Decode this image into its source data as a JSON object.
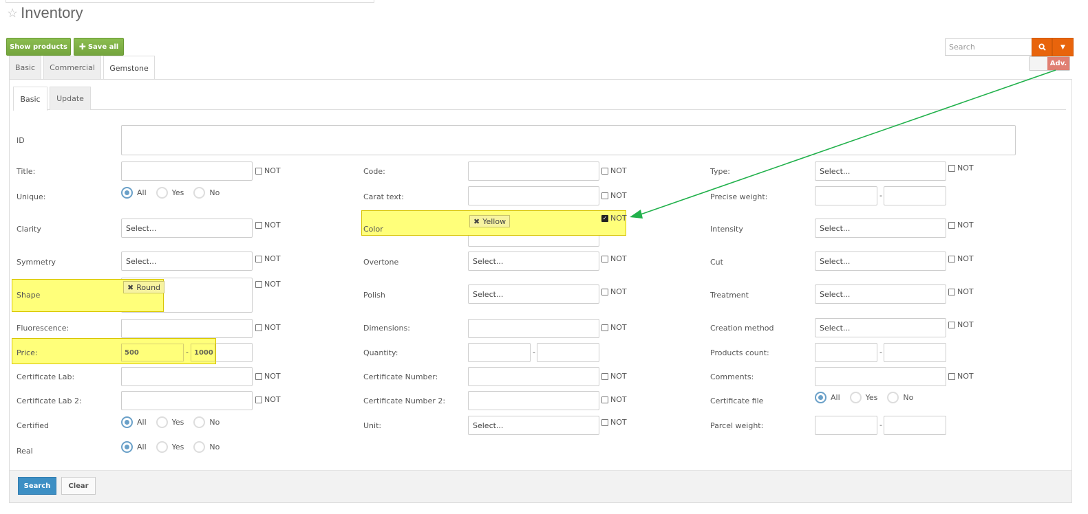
{
  "header": {
    "title": "Inventory"
  },
  "toolbar": {
    "show_products": "Show products",
    "save_all": "Save all"
  },
  "search": {
    "placeholder": "Search",
    "adv": "Adv."
  },
  "tabs": [
    "Basic",
    "Commercial",
    "Gemstone"
  ],
  "subtabs": [
    "Basic",
    "Update"
  ],
  "labels": {
    "id": "ID",
    "title": "Title:",
    "unique": "Unique:",
    "clarity": "Clarity",
    "symmetry": "Symmetry",
    "shape": "Shape",
    "fluorescence": "Fluorescence:",
    "price": "Price:",
    "cert_lab": "Certificate Lab:",
    "cert_lab2": "Certificate Lab 2:",
    "certified": "Certified",
    "real": "Real",
    "code": "Code:",
    "carat_text": "Carat text:",
    "color": "Color",
    "overtone": "Overtone",
    "polish": "Polish",
    "dimensions": "Dimensions:",
    "quantity": "Quantity:",
    "cert_number": "Certificate Number:",
    "cert_number2": "Certificate Number 2:",
    "unit": "Unit:",
    "type": "Type:",
    "precise_weight": "Precise weight:",
    "intensity": "Intensity",
    "cut": "Cut",
    "treatment": "Treatment",
    "creation_method": "Creation method",
    "products_count": "Products count:",
    "comments": "Comments:",
    "cert_file": "Certificate file",
    "parcel_weight": "Parcel weight:"
  },
  "common": {
    "not": "NOT",
    "select": "Select...",
    "all": "All",
    "yes": "Yes",
    "no": "No",
    "dash": "-"
  },
  "values": {
    "color_tag": "Yellow",
    "shape_tag": "Round",
    "price_min": "500",
    "price_max": "1000"
  },
  "footer": {
    "search": "Search",
    "clear": "Clear"
  }
}
